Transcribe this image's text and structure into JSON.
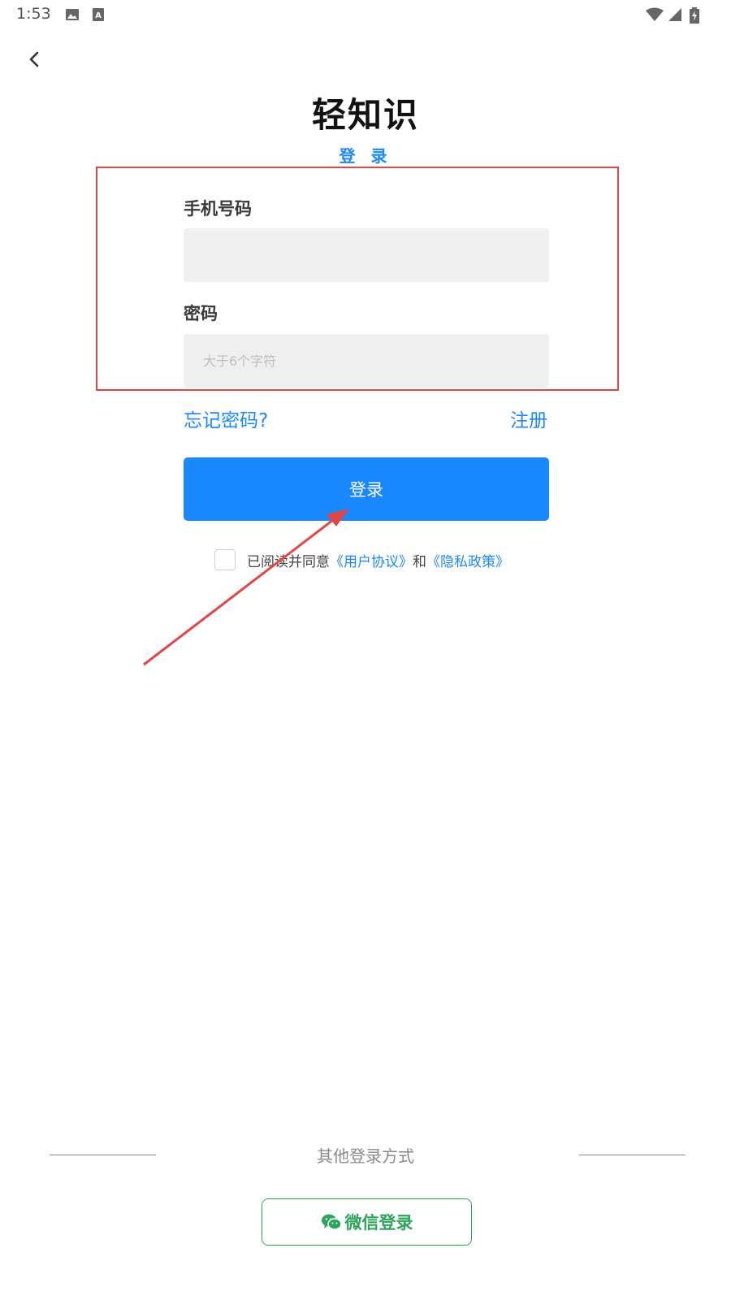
{
  "status_bar": {
    "time": "1:53",
    "icons": [
      "image-icon",
      "a-box-icon",
      "wifi-icon",
      "signal-icon",
      "battery-charging-icon"
    ]
  },
  "header": {
    "back_icon": "chevron-left-icon",
    "app_title": "轻知识",
    "subtitle": "登 录"
  },
  "form": {
    "phone_label": "手机号码",
    "phone_value": "",
    "phone_placeholder": "",
    "password_label": "密码",
    "password_value": "",
    "password_placeholder": "大于6个字符"
  },
  "links": {
    "forgot_password": "忘记密码?",
    "register": "注册"
  },
  "login_button": "登录",
  "agreement": {
    "prefix": "已阅读并同意",
    "user_agreement": "《用户协议》",
    "and": "和",
    "privacy_policy": "《隐私政策》",
    "checked": false
  },
  "other_login": {
    "label": "其他登录方式",
    "wechat_label": "微信登录",
    "wechat_icon": "wechat-icon"
  },
  "colors": {
    "accent": "#1a88ff",
    "wechat_green": "#2ca55a",
    "annotation_red": "#e04848",
    "input_bg": "#efefef"
  }
}
